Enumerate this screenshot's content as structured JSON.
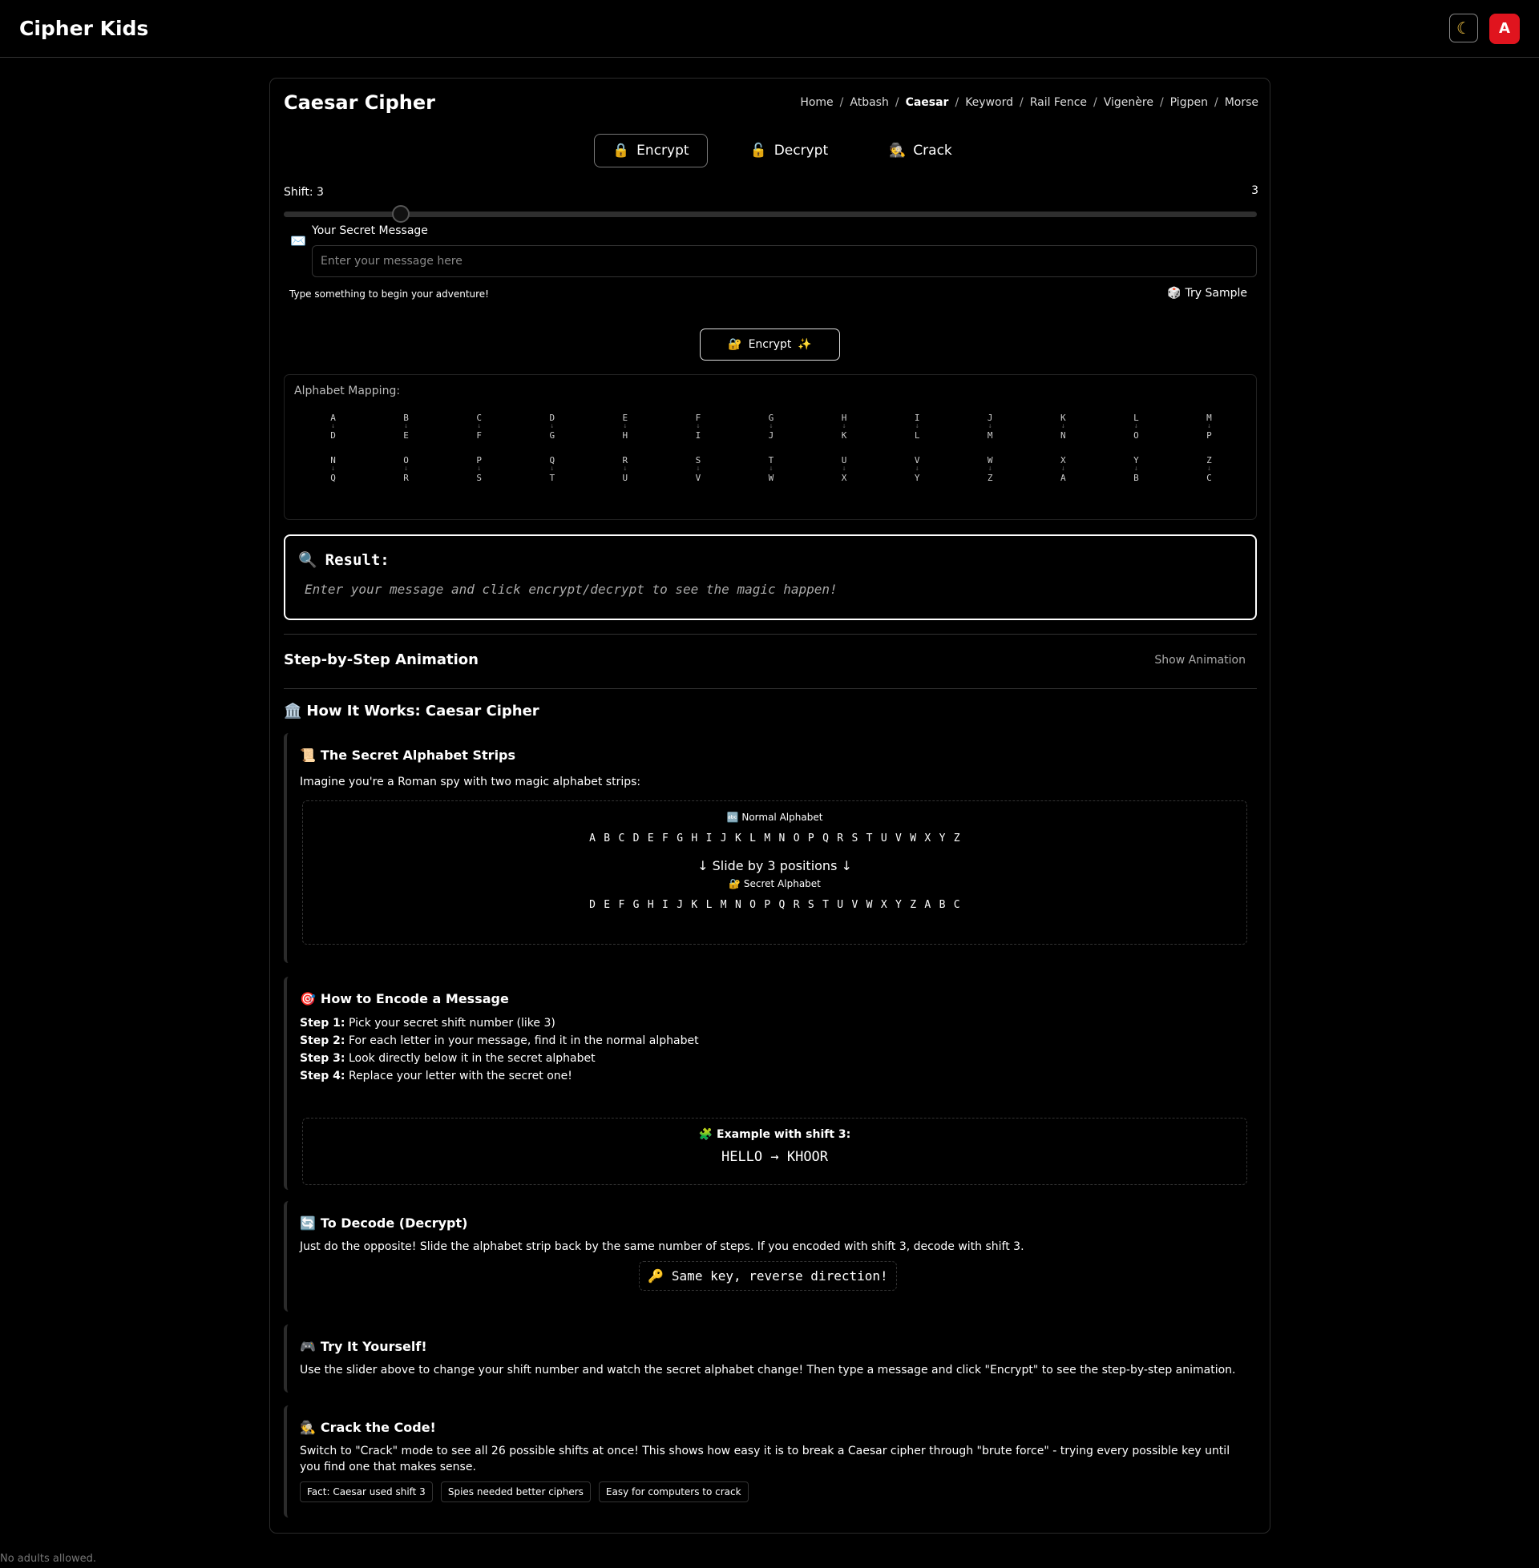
{
  "app": {
    "brand": "Cipher Kids",
    "theme_icon": "moon-icon",
    "avatar_letter": "A"
  },
  "page": {
    "title": "Caesar Cipher",
    "breadcrumbs": [
      "Home",
      "Atbash",
      "Caesar",
      "Keyword",
      "Rail Fence",
      "Vigenère",
      "Pigpen",
      "Morse"
    ],
    "current_breadcrumb": "Caesar"
  },
  "modes": [
    {
      "icon": "🔒",
      "label": "Encrypt",
      "active": true
    },
    {
      "icon": "🔓",
      "label": "Decrypt",
      "active": false
    },
    {
      "icon": "🕵️",
      "label": "Crack",
      "active": false
    }
  ],
  "shift": {
    "label": "Shift: 3",
    "value": "3",
    "level": 3,
    "min": 0,
    "max": 25
  },
  "message": {
    "icon": "✉️",
    "label": "Your Secret Message",
    "placeholder": "Enter your message here",
    "value": "",
    "hint": "Type something to begin your adventure!",
    "sample_icon": "🎲",
    "sample_label": "Try Sample"
  },
  "action": {
    "icon": "🔐",
    "label": "Encrypt",
    "sparkle": "✨"
  },
  "mapping": {
    "label": "Alphabet Mapping:",
    "arrow": "↓",
    "pairs": [
      [
        "A",
        "D"
      ],
      [
        "B",
        "E"
      ],
      [
        "C",
        "F"
      ],
      [
        "D",
        "G"
      ],
      [
        "E",
        "H"
      ],
      [
        "F",
        "I"
      ],
      [
        "G",
        "J"
      ],
      [
        "H",
        "K"
      ],
      [
        "I",
        "L"
      ],
      [
        "J",
        "M"
      ],
      [
        "K",
        "N"
      ],
      [
        "L",
        "O"
      ],
      [
        "M",
        "P"
      ],
      [
        "N",
        "Q"
      ],
      [
        "O",
        "R"
      ],
      [
        "P",
        "S"
      ],
      [
        "Q",
        "T"
      ],
      [
        "R",
        "U"
      ],
      [
        "S",
        "V"
      ],
      [
        "T",
        "W"
      ],
      [
        "U",
        "X"
      ],
      [
        "V",
        "Y"
      ],
      [
        "W",
        "Z"
      ],
      [
        "X",
        "A"
      ],
      [
        "Y",
        "B"
      ],
      [
        "Z",
        "C"
      ]
    ]
  },
  "result": {
    "icon": "🔍",
    "title": "Result:",
    "placeholder": "Enter your message and click encrypt/decrypt to see the magic happen!"
  },
  "animation": {
    "title": "Step-by-Step Animation",
    "toggle": "Show Animation"
  },
  "how": {
    "icon": "🏛️",
    "title": "How It Works: Caesar Cipher",
    "strips": {
      "icon": "📜",
      "title": "The Secret Alphabet Strips",
      "intro": "Imagine you're a Roman spy with two magic alphabet strips:",
      "normal_caption": "🔤 Normal Alphabet",
      "normal": [
        "A",
        "B",
        "C",
        "D",
        "E",
        "F",
        "G",
        "H",
        "I",
        "J",
        "K",
        "L",
        "M",
        "N",
        "O",
        "P",
        "Q",
        "R",
        "S",
        "T",
        "U",
        "V",
        "W",
        "X",
        "Y",
        "Z"
      ],
      "slide_note": "↓ Slide by 3 positions ↓",
      "secret_caption": "🔐 Secret Alphabet",
      "secret": [
        "D",
        "E",
        "F",
        "G",
        "H",
        "I",
        "J",
        "K",
        "L",
        "M",
        "N",
        "O",
        "P",
        "Q",
        "R",
        "S",
        "T",
        "U",
        "V",
        "W",
        "X",
        "Y",
        "Z",
        "A",
        "B",
        "C"
      ]
    },
    "encode": {
      "icon": "🎯",
      "title": "How to Encode a Message",
      "steps": [
        {
          "label": "Step 1:",
          "text": " Pick your secret shift number (like 3)"
        },
        {
          "label": "Step 2:",
          "text": " For each letter in your message, find it in the normal alphabet"
        },
        {
          "label": "Step 3:",
          "text": " Look directly below it in the secret alphabet"
        },
        {
          "label": "Step 4:",
          "text": " Replace your letter with the secret one!"
        }
      ],
      "example_caption": "🧩 Example with shift 3:",
      "example_value": "HELLO → KHOOR"
    },
    "decode": {
      "icon": "🔄",
      "title": "To Decode (Decrypt)",
      "text": "Just do the opposite! Slide the alphabet strip back by the same number of steps. If you encoded with shift 3, decode with shift 3.",
      "key_note": "🔑 Same key, reverse direction!"
    },
    "try": {
      "icon": "🎮",
      "title": "Try It Yourself!",
      "text": "Use the slider above to change your shift number and watch the secret alphabet change! Then type a message and click \"Encrypt\" to see the step-by-step animation."
    },
    "crack": {
      "icon": "🕵️",
      "title": "Crack the Code!",
      "text": "Switch to \"Crack\" mode to see all 26 possible shifts at once! This shows how easy it is to break a Caesar cipher through \"brute force\" - trying every possible key until you find one that makes sense.",
      "tags": [
        "Fact: Caesar used shift 3",
        "Spies needed better ciphers",
        "Easy for computers to crack"
      ]
    }
  },
  "footer": "No adults allowed."
}
